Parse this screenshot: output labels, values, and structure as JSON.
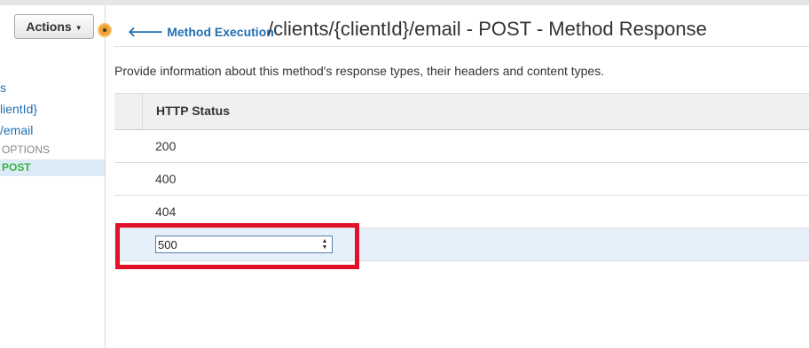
{
  "sidebar": {
    "actions_label": "Actions",
    "tree": [
      {
        "label": "s"
      },
      {
        "label": "lientId}"
      },
      {
        "label": "/email"
      }
    ],
    "methods": [
      {
        "label": "OPTIONS"
      },
      {
        "label": "POST"
      }
    ]
  },
  "header": {
    "back_link": "Method Execution",
    "title": "/clients/{clientId}/email - POST - Method Response"
  },
  "main": {
    "description": "Provide information about this method's response types, their headers and content types.",
    "table": {
      "column_header": "HTTP Status",
      "rows": [
        "200",
        "400",
        "404"
      ],
      "editing_value": "500"
    }
  },
  "colors": {
    "link": "#1f6fb2",
    "post_method": "#3db43d",
    "highlight": "#e3102a"
  }
}
